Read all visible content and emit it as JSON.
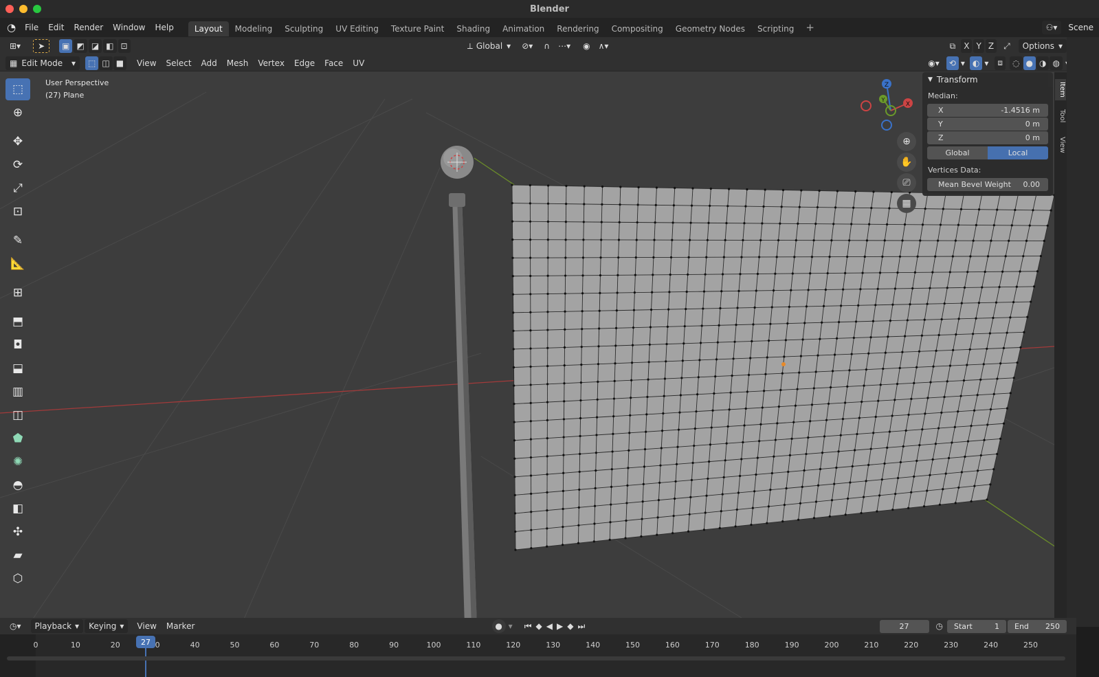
{
  "window": {
    "title": "Blender"
  },
  "menus": [
    "File",
    "Edit",
    "Render",
    "Window",
    "Help"
  ],
  "workspace_tabs": [
    "Layout",
    "Modeling",
    "Sculpting",
    "UV Editing",
    "Texture Paint",
    "Shading",
    "Animation",
    "Rendering",
    "Compositing",
    "Geometry Nodes",
    "Scripting"
  ],
  "active_workspace": "Layout",
  "scene_label": "Scene",
  "header": {
    "orientation": "Global",
    "axes": [
      "X",
      "Y",
      "Z"
    ],
    "options_label": "Options"
  },
  "header2": {
    "mode": "Edit Mode",
    "menus": [
      "View",
      "Select",
      "Add",
      "Mesh",
      "Vertex",
      "Edge",
      "Face",
      "UV"
    ]
  },
  "viewport": {
    "perspective": "User Perspective",
    "object_info": "(27) Plane",
    "gizmo": {
      "x": "X",
      "y": "Y",
      "z": "Z"
    }
  },
  "npanel": {
    "section": "Transform",
    "median_label": "Median:",
    "x_label": "X",
    "x_value": "-1.4516 m",
    "y_label": "Y",
    "y_value": "0 m",
    "z_label": "Z",
    "z_value": "0 m",
    "global_label": "Global",
    "local_label": "Local",
    "vertices_data_label": "Vertices Data:",
    "bevel_label": "Mean Bevel Weight",
    "bevel_value": "0.00",
    "tabs": [
      "Item",
      "Tool",
      "View"
    ]
  },
  "timeline": {
    "menus": [
      "Playback",
      "Keying",
      "View",
      "Marker"
    ],
    "current_frame": "27",
    "start_label": "Start",
    "start_value": "1",
    "end_label": "End",
    "end_value": "250",
    "ticks": [
      "0",
      "10",
      "20",
      "30",
      "40",
      "50",
      "60",
      "70",
      "80",
      "90",
      "100",
      "110",
      "120",
      "130",
      "140",
      "150",
      "160",
      "170",
      "180",
      "190",
      "200",
      "210",
      "220",
      "230",
      "240",
      "250"
    ]
  },
  "colors": {
    "accent": "#4772b3",
    "viewport_bg": "#3d3d3d",
    "mesh": "#a3a3a3"
  }
}
